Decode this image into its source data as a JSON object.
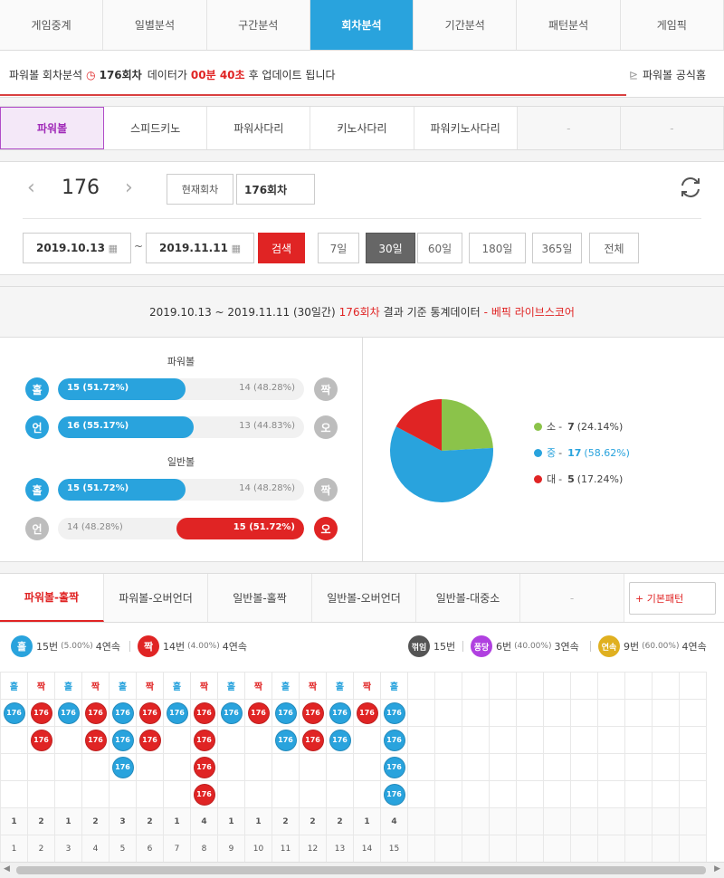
{
  "top_tabs": [
    "게임중계",
    "일별분석",
    "구간분석",
    "회차분석",
    "기간분석",
    "패턴분석",
    "게임픽"
  ],
  "top_tab_active": 3,
  "notice": {
    "prefix": "파워볼 회차분석",
    "round": "176회차",
    "mid": "데이터가",
    "time": "00분 40초",
    "suffix": "후 업데이트 됩니다",
    "home": "파워볼 공식홈"
  },
  "game_tabs": [
    "파워볼",
    "스피드키노",
    "파워사다리",
    "키노사다리",
    "파워키노사다리",
    "-",
    "-"
  ],
  "game_tab_active": 0,
  "round_nav": {
    "round": "176",
    "current_btn": "현재회차",
    "round_input": "176회차"
  },
  "date_range": {
    "from": "2019.10.13",
    "to": "2019.11.11",
    "search": "검색",
    "tilde": "~"
  },
  "periods": [
    "7일",
    "30일",
    "60일",
    "180일",
    "365일",
    "전체"
  ],
  "period_active": 1,
  "stats": {
    "header_range": "2019.10.13 ~ 2019.11.11 (30일간)",
    "header_round": "176회차",
    "header_text": "결과 기준 통계데이터",
    "header_brand": "- 베픽 라이브스코어",
    "powerball_title": "파워볼",
    "normal_title": "일반볼",
    "rows": [
      {
        "left": "홀",
        "right": "짝",
        "left_text": "15 (51.72%)",
        "right_text": "14 (48.28%)",
        "ratio": 0.5172,
        "winner": "left",
        "left_color": "#29a3dd",
        "right_color": "#bdbdbd"
      },
      {
        "left": "언",
        "right": "오",
        "left_text": "16 (55.17%)",
        "right_text": "13 (44.83%)",
        "ratio": 0.5517,
        "winner": "left",
        "left_color": "#29a3dd",
        "right_color": "#bdbdbd"
      },
      {
        "left": "홀",
        "right": "짝",
        "left_text": "15 (51.72%)",
        "right_text": "14 (48.28%)",
        "ratio": 0.5172,
        "winner": "left",
        "left_color": "#29a3dd",
        "right_color": "#bdbdbd"
      },
      {
        "left": "언",
        "right": "오",
        "left_text": "14 (48.28%)",
        "right_text": "15 (51.72%)",
        "ratio": 0.5172,
        "winner": "right",
        "left_color": "#bdbdbd",
        "right_color": "#e02424"
      }
    ],
    "pie": [
      {
        "label": "소",
        "count": "7",
        "pct": "(24.14%)",
        "value": 24.14,
        "color": "#8bc34a"
      },
      {
        "label": "중",
        "count": "17",
        "pct": "(58.62%)",
        "value": 58.62,
        "color": "#29a3dd"
      },
      {
        "label": "대",
        "count": "5",
        "pct": "(17.24%)",
        "value": 17.24,
        "color": "#e02424"
      }
    ]
  },
  "pattern_tabs": [
    "파워볼-홀짝",
    "파워볼-오버언더",
    "일반볼-홀짝",
    "일반볼-오버언더",
    "일반볼-대중소",
    "-"
  ],
  "pattern_tab_active": 0,
  "basic_pattern": "+ 기본패턴",
  "summary": {
    "odd": {
      "ball": "홀",
      "count": "15번",
      "pct": "(5.00%)",
      "streak": "4연속"
    },
    "even": {
      "ball": "짝",
      "count": "14번",
      "pct": "(4.00%)",
      "streak": "4연속"
    },
    "bend": {
      "ball": "꺾임",
      "count": "15번"
    },
    "bounce": {
      "ball": "퐁당",
      "count": "6번",
      "pct": "(40.00%)",
      "streak": "3연속"
    },
    "cont": {
      "ball": "연속",
      "count": "9번",
      "pct": "(60.00%)",
      "streak": "4연속"
    }
  },
  "grid": {
    "columns": [
      {
        "head": "홀",
        "n": 1
      },
      {
        "head": "짝",
        "n": 2
      },
      {
        "head": "홀",
        "n": 1
      },
      {
        "head": "짝",
        "n": 2
      },
      {
        "head": "홀",
        "n": 3
      },
      {
        "head": "짝",
        "n": 2
      },
      {
        "head": "홀",
        "n": 1
      },
      {
        "head": "짝",
        "n": 4
      },
      {
        "head": "홀",
        "n": 1
      },
      {
        "head": "짝",
        "n": 1
      },
      {
        "head": "홀",
        "n": 2
      },
      {
        "head": "짝",
        "n": 2
      },
      {
        "head": "홀",
        "n": 2
      },
      {
        "head": "짝",
        "n": 1
      },
      {
        "head": "홀",
        "n": 4
      }
    ],
    "ball_label": "176",
    "total_cols": 26,
    "odd_color": "#29a3dd",
    "even_color": "#e02424"
  },
  "colors": {
    "accent": "#29a3dd",
    "red": "#e02424",
    "purple": "#a02ab8",
    "gray": "#555555",
    "gold": "#e0b020",
    "violet": "#b040e0"
  }
}
